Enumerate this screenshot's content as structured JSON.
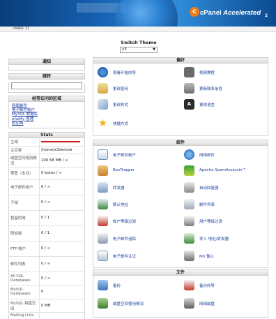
{
  "header": {
    "logo_text": "cPanel",
    "logo_accent": "Accelerated",
    "version": "2"
  },
  "userbar": {
    "user": "cPANEL 11"
  },
  "theme": {
    "label": "Switch Theme",
    "selected": "x3"
  },
  "sidebar": {
    "notice_title": "通知",
    "search_title": "跳转",
    "frequent_title": "经常访问的区域",
    "frequent_links": [
      "网络邮件",
      "电子邮件帐户",
      "MySQL 数据库",
      "phpMy 管理",
      "附加域"
    ],
    "stats_title": "Stats",
    "stats": [
      {
        "k": "主域",
        "v": ""
      },
      {
        "k": "主目录",
        "v": "/home/x3demob"
      },
      {
        "k": "磁盘空间使用情况",
        "v": "100.58 MB / ∞"
      },
      {
        "k": "带宽（本月）",
        "v": "0 bytes / ∞"
      },
      {
        "k": "电子邮件帐户",
        "v": "0 / ∞"
      },
      {
        "k": "子域",
        "v": "0 / ∞"
      },
      {
        "k": "暂留的域",
        "v": "0 / 1"
      },
      {
        "k": "附加域",
        "v": "0 / 1"
      },
      {
        "k": "FTP 帐户",
        "v": "0 / ∞"
      },
      {
        "k": "邮件列表",
        "v": "0 / ∞"
      },
      {
        "k": "All SQL Databases",
        "v": "0 / ∞"
      },
      {
        "k": "MySQL Databases",
        "v": "0"
      },
      {
        "k": "MySQL 磁盘空间",
        "v": "0 MB"
      },
      {
        "k": "Mailing Lists",
        "v": ""
      }
    ]
  },
  "prefs": {
    "title": "偏好",
    "items": [
      "观看开始向导",
      "视频教程",
      "更改密码",
      "更新联系信息",
      "更改样式",
      "更改语言",
      "快捷方式"
    ],
    "icons": [
      "play-icon",
      "video-icon",
      "password-icon",
      "contact-icon",
      "style-icon",
      "language-icon",
      "star-icon"
    ]
  },
  "mail": {
    "title": "邮件",
    "items": [
      "电子邮件帐户",
      "网络邮件",
      "BoxTrapper",
      "Apache SpamAssassin™",
      "转发器",
      "自动回复器",
      "默认地址",
      "邮件列表",
      "帐户等级过滤",
      "用户等级过滤",
      "电子邮件追踪",
      "导入 地址/转发器",
      "电子邮件认证",
      "MX 输入"
    ],
    "icons": [
      "envelope-icon",
      "webmail-icon",
      "boxtrapper-icon",
      "spamassassin-icon",
      "forwarder-icon",
      "autoresponder-icon",
      "default-address-icon",
      "mailing-list-icon",
      "filter-icon",
      "user-filter-icon",
      "tracking-icon",
      "import-icon",
      "authentication-icon",
      "mx-icon"
    ]
  },
  "files": {
    "title": "文件",
    "items": [
      "备份",
      "备份向导",
      "磁盘空间使用情况",
      "网络磁盘"
    ],
    "icons": [
      "backup-icon",
      "backup-wizard-icon",
      "disk-usage-icon",
      "web-disk-icon"
    ]
  },
  "colors": {
    "header_dark": "#0a3d7a",
    "header_light": "#2f8ad8",
    "link": "#1a3e9e",
    "accent_orange": "#f27a14",
    "redact": "#d21a1a"
  }
}
